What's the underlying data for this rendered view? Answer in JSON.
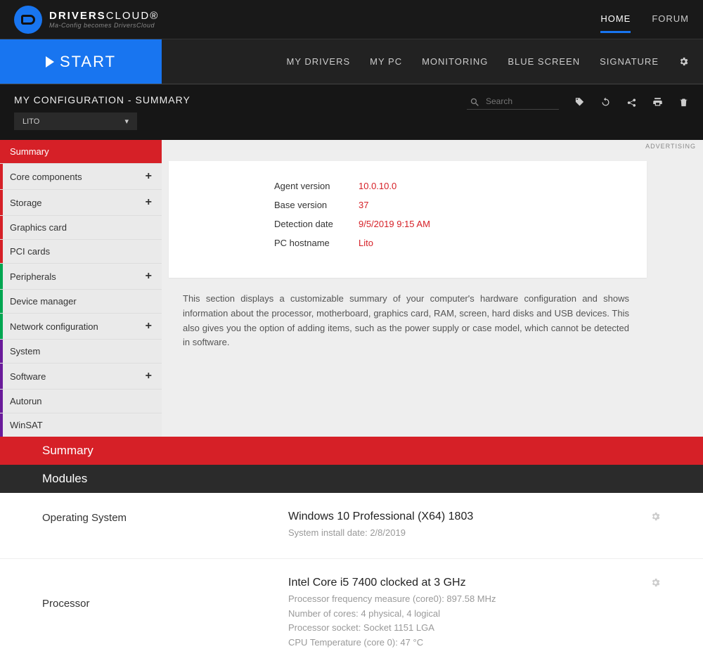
{
  "brand": {
    "strong": "DRIVERS",
    "light": "CLOUD®",
    "tagline": "Ma-Config becomes DriversCloud"
  },
  "topnav": {
    "home": "HOME",
    "forum": "FORUM"
  },
  "start_label": "START",
  "secnav": [
    "MY DRIVERS",
    "MY PC",
    "MONITORING",
    "BLUE SCREEN",
    "SIGNATURE"
  ],
  "page_title": "MY CONFIGURATION - SUMMARY",
  "dropdown_value": "LITO",
  "search_placeholder": "Search",
  "ad_label": "ADVERTISING",
  "sidebar": [
    {
      "label": "Summary",
      "active": true
    },
    {
      "label": "Core components",
      "expand": true,
      "grp": "red"
    },
    {
      "label": "Storage",
      "expand": true,
      "grp": "red"
    },
    {
      "label": "Graphics card",
      "grp": "red"
    },
    {
      "label": "PCI cards",
      "grp": "red"
    },
    {
      "label": "Peripherals",
      "expand": true,
      "grp": "green"
    },
    {
      "label": "Device manager",
      "grp": "green"
    },
    {
      "label": "Network configuration",
      "expand": true,
      "grp": "green"
    },
    {
      "label": "System",
      "grp": "purple"
    },
    {
      "label": "Software",
      "expand": true,
      "grp": "purple"
    },
    {
      "label": "Autorun",
      "grp": "purple"
    },
    {
      "label": "WinSAT",
      "grp": "purple"
    }
  ],
  "info": {
    "agent_version_k": "Agent version",
    "agent_version_v": "10.0.10.0",
    "base_version_k": "Base version",
    "base_version_v": "37",
    "detection_date_k": "Detection date",
    "detection_date_v": "9/5/2019 9:15 AM",
    "hostname_k": "PC hostname",
    "hostname_v": "Lito"
  },
  "description": "This section displays a customizable summary of your computer's hardware configuration and shows information about the processor, motherboard, graphics card, RAM, screen, hard disks and USB devices. This also gives you the option of adding items, such as the power supply or case model, which cannot be detected in software.",
  "sections": {
    "summary": "Summary",
    "modules": "Modules"
  },
  "os": {
    "label": "Operating System",
    "title": "Windows 10 Professional (X64) 1803",
    "line1": "System install date: 2/8/2019"
  },
  "cpu": {
    "label": "Processor",
    "title": "Intel Core i5 7400 clocked at 3 GHz",
    "line1": "Processor frequency measure (core0): 897.58 MHz",
    "line2": "Number of cores: 4 physical, 4 logical",
    "line3": "Processor socket: Socket 1151 LGA",
    "line4": "CPU Temperature (core 0): 47 °C"
  }
}
